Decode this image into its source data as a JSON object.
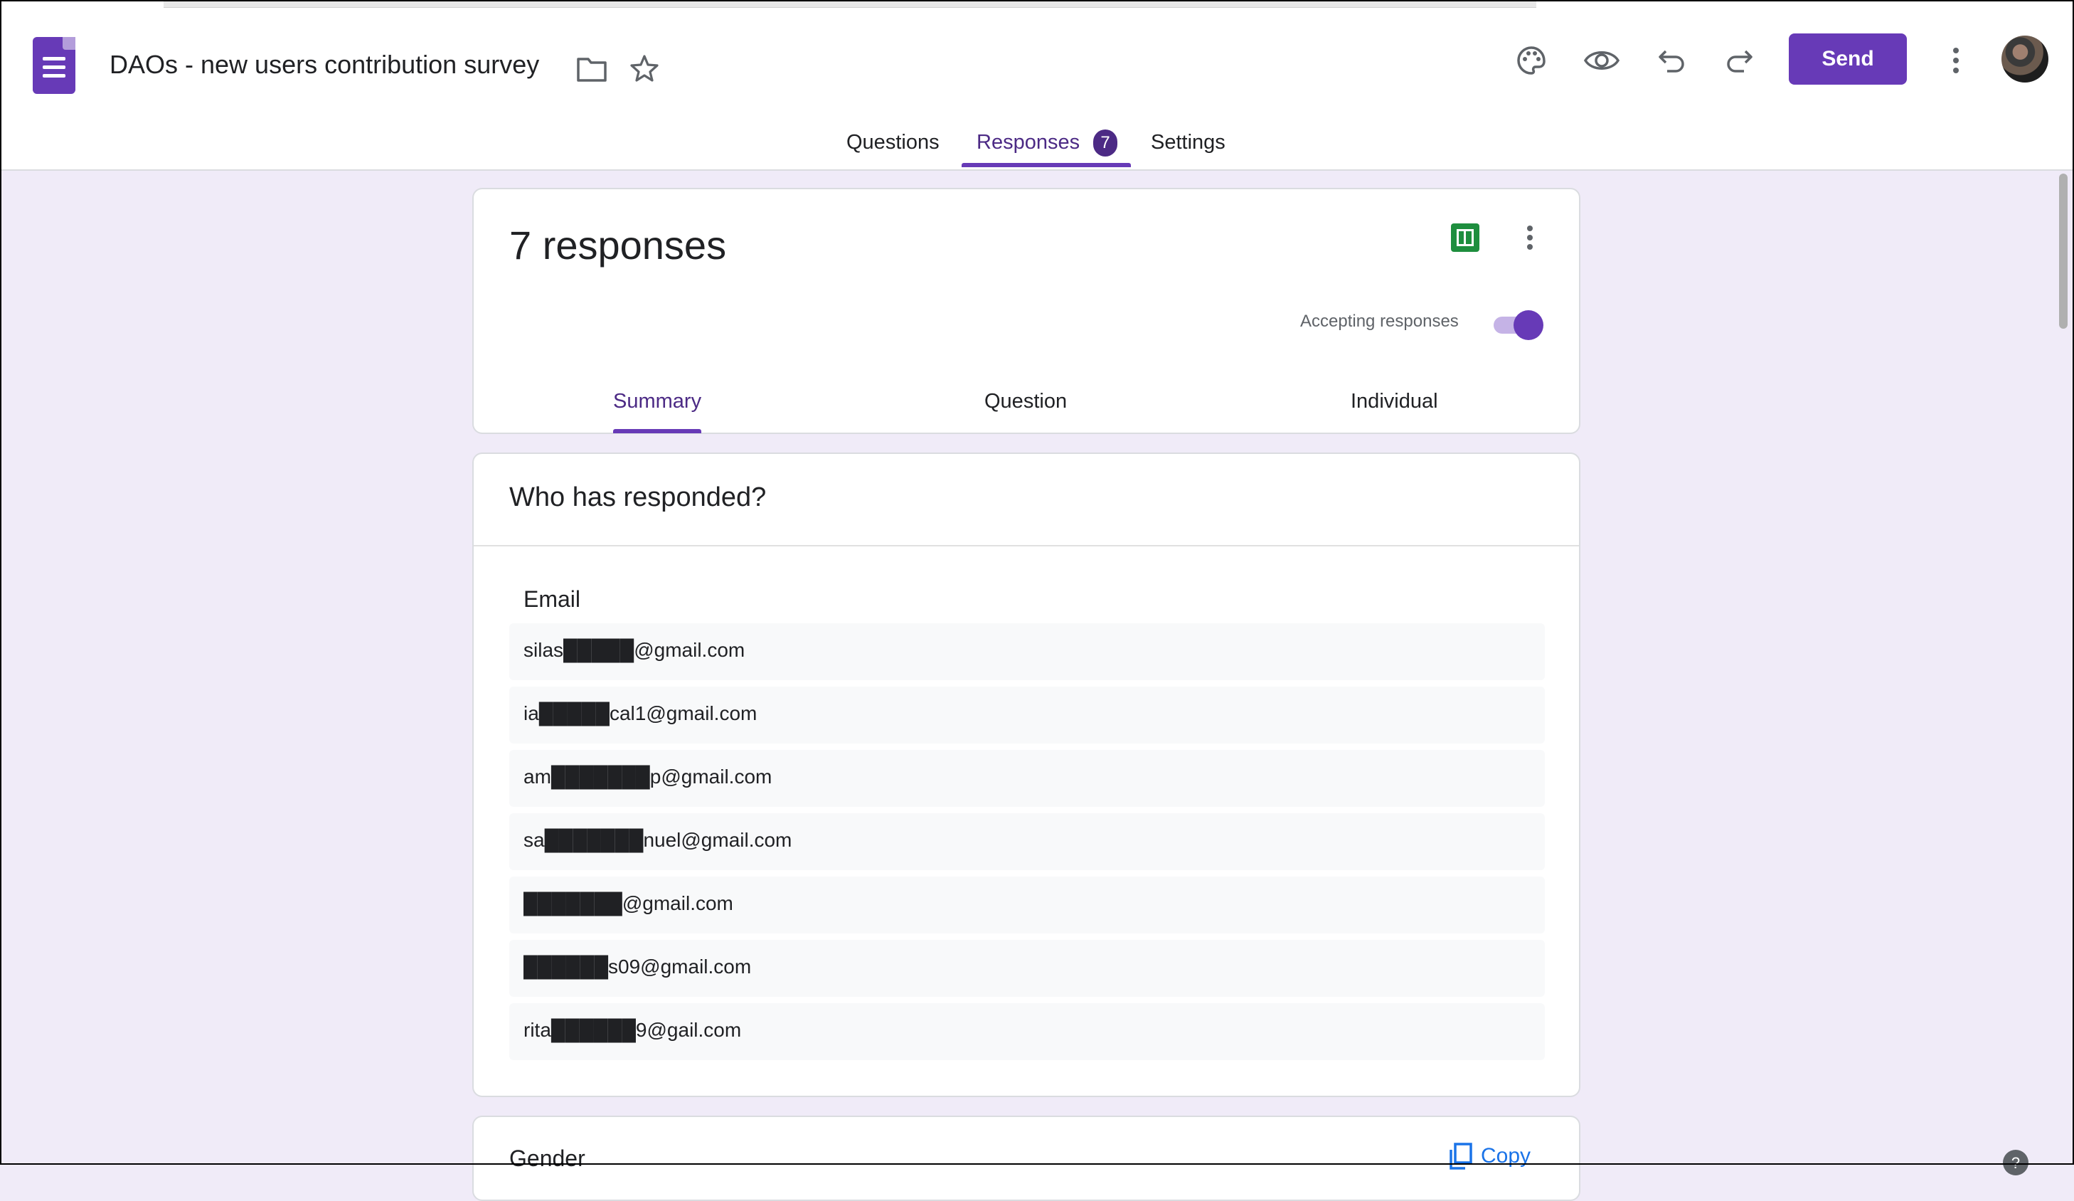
{
  "header": {
    "title": "DAOs - new users contribution survey",
    "send_label": "Send"
  },
  "tabs": [
    {
      "label": "Questions"
    },
    {
      "label": "Responses",
      "badge": "7"
    },
    {
      "label": "Settings"
    }
  ],
  "summary_card": {
    "count_label": "7 responses",
    "accepting_label": "Accepting responses",
    "accepting_on": true,
    "subtabs": [
      {
        "label": "Summary"
      },
      {
        "label": "Question"
      },
      {
        "label": "Individual"
      }
    ]
  },
  "responders_card": {
    "title": "Who has responded?",
    "column_header": "Email",
    "emails": [
      "silas█████@gmail.com",
      "ia█████cal1@gmail.com",
      "am███████p@gmail.com",
      "sa███████nuel@gmail.com",
      "███████@gmail.com",
      "██████s09@gmail.com",
      "rita██████9@gail.com"
    ]
  },
  "next_card": {
    "title": "Gender",
    "copy_label": "Copy"
  },
  "colors": {
    "accent": "#673ab7",
    "background": "#f0ebf8"
  }
}
